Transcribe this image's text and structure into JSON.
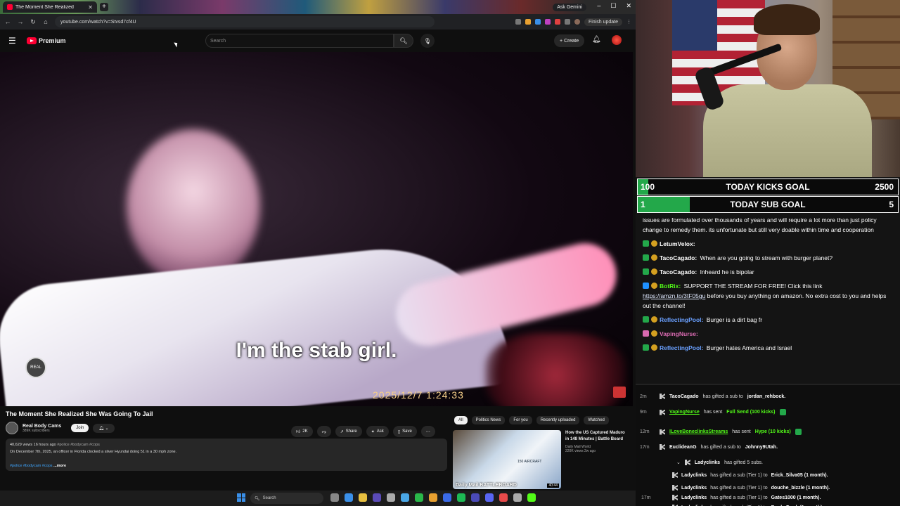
{
  "browser": {
    "tab_title": "The Moment She Realized",
    "url": "youtube.com/watch?v=Stvsd7cf4U",
    "ask_gemini": "Ask Gemini",
    "finish_update": "Finish update"
  },
  "youtube": {
    "brand": "Premium",
    "search_placeholder": "Search",
    "create_label": "Create",
    "subtitle": "I'm the stab girl.",
    "timestamp": "2025/12/7    1:24:33",
    "watermark": "REAL",
    "video_title": "The Moment She Realized She Was Going To Jail",
    "channel_name": "Real Body Cams",
    "channel_subs": "389K subscribers",
    "join_label": "Join",
    "likes": "2K",
    "share_label": "Share",
    "ask_label": "Ask",
    "save_label": "Save",
    "desc_stats": "40,629 views  16 hours ago",
    "desc_stats_tags": "#police #bodycam #cops",
    "desc_text": "On December 7th, 2025, an officer in Florida clocked a silver Hyundai doing 51 in a 30 mph zone.",
    "desc_tags": "#police #bodycam #cops",
    "desc_more": "...more",
    "chips": [
      "All",
      "Politics News",
      "For you",
      "Recently uploaded",
      "Watched"
    ],
    "rec": {
      "title": "How the US Captured Maduro in 148 Minutes | Battle Board",
      "channel": "Daily Mail World",
      "stats": "220K views  2w ago",
      "duration": "40:44",
      "thumb_caption": "Daily Mail  BATTLEBOARD",
      "thumb_tag": "150 AIRCRAFT"
    }
  },
  "taskbar": {
    "search_label": "Search"
  },
  "overlay": {
    "kicks_goal": {
      "label": "TODAY KICKS GOAL",
      "current": "100",
      "target": "2500",
      "progress": 0.04
    },
    "sub_goal": {
      "label": "TODAY SUB GOAL",
      "current": "1",
      "target": "5",
      "progress": 0.2
    },
    "chat": [
      {
        "user": "",
        "text": "issues are formulated over thousands of years and will require a lot more than just policy change to remedy them. its unfortunate but still very doable within time and cooperation",
        "color": "#ffffff"
      },
      {
        "user": "LetumVelox:",
        "text": "",
        "color": "#ffffff"
      },
      {
        "user": "TacoCagado:",
        "text": "When are you going to stream with burger planet?",
        "color": "#ffffff"
      },
      {
        "user": "TacoCagado:",
        "text": "Inheard he is bipolar",
        "color": "#ffffff"
      },
      {
        "user": "BotRix:",
        "text": "SUPPORT THE STREAM FOR FREE! Click this link",
        "link": "https://amzn.to/3tF05gu",
        "text2": "before you buy anything on amazon. No extra cost to you and helps out the channel!",
        "color": "#53fc18"
      },
      {
        "user": "ReflectingPool:",
        "text": "Burger is a dirt bag fr",
        "color": "#6aa0ff"
      },
      {
        "user": "VapingNurse:",
        "text": "",
        "color": "#d86ab0"
      },
      {
        "user": "ReflectingPool:",
        "text": "Burger hates America and Israel",
        "color": "#6aa0ff"
      }
    ],
    "events": [
      {
        "time": "2m",
        "user": "TacoCagado",
        "pre": "has gifted a sub to",
        "post": "jordan_rehbock."
      },
      {
        "time": "9m",
        "user": "VapingNurse",
        "pre": "has sent",
        "hl": "Full Send (100 kicks)"
      },
      {
        "time": "12m",
        "user": "ILoveBoneclinksStreams",
        "pre": "has sent",
        "hl": "Hype (10 kicks)"
      },
      {
        "time": "17m",
        "user": "EuclideanG",
        "pre": "has gifted a sub to",
        "post": "Johnny9Utah."
      },
      {
        "time": "",
        "user": "Ladyclinks",
        "pre": "has gifted 5 subs.",
        "post": ""
      },
      {
        "time": "",
        "user": "Ladyclinks",
        "pre": "has gifted a sub (Tier 1) to",
        "post": "Erick_Silva05 (1 month)."
      },
      {
        "time": "",
        "user": "Ladyclinks",
        "pre": "has gifted a sub (Tier 1) to",
        "post": "douche_bizzle (1 month)."
      },
      {
        "time": "17m",
        "user": "Ladyclinks",
        "pre": "has gifted a sub (Tier 1) to",
        "post": "Gates1000 (1 month)."
      },
      {
        "time": "",
        "user": "Ladyclinks",
        "pre": "has gifted a sub (Tier 1) to",
        "post": "Bonk_Donk (1 month)."
      }
    ]
  }
}
